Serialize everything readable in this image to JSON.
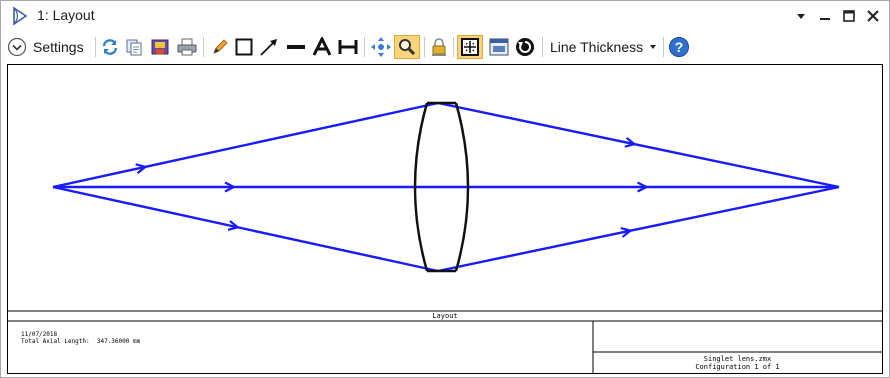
{
  "window": {
    "title": "1: Layout"
  },
  "toolbar": {
    "settings_label": "Settings",
    "line_thickness_label": "Line Thickness"
  },
  "info": {
    "section_label": "Layout",
    "date": "11/07/2018",
    "total_axial_length": "Total Axial Length:  347.36000 mm",
    "file_name": "Singlet lens.zmx",
    "configuration": "Configuration 1 of 1"
  },
  "colors": {
    "ray": "#1a1aff",
    "lens": "#111111",
    "accent": "#f7d37a"
  }
}
